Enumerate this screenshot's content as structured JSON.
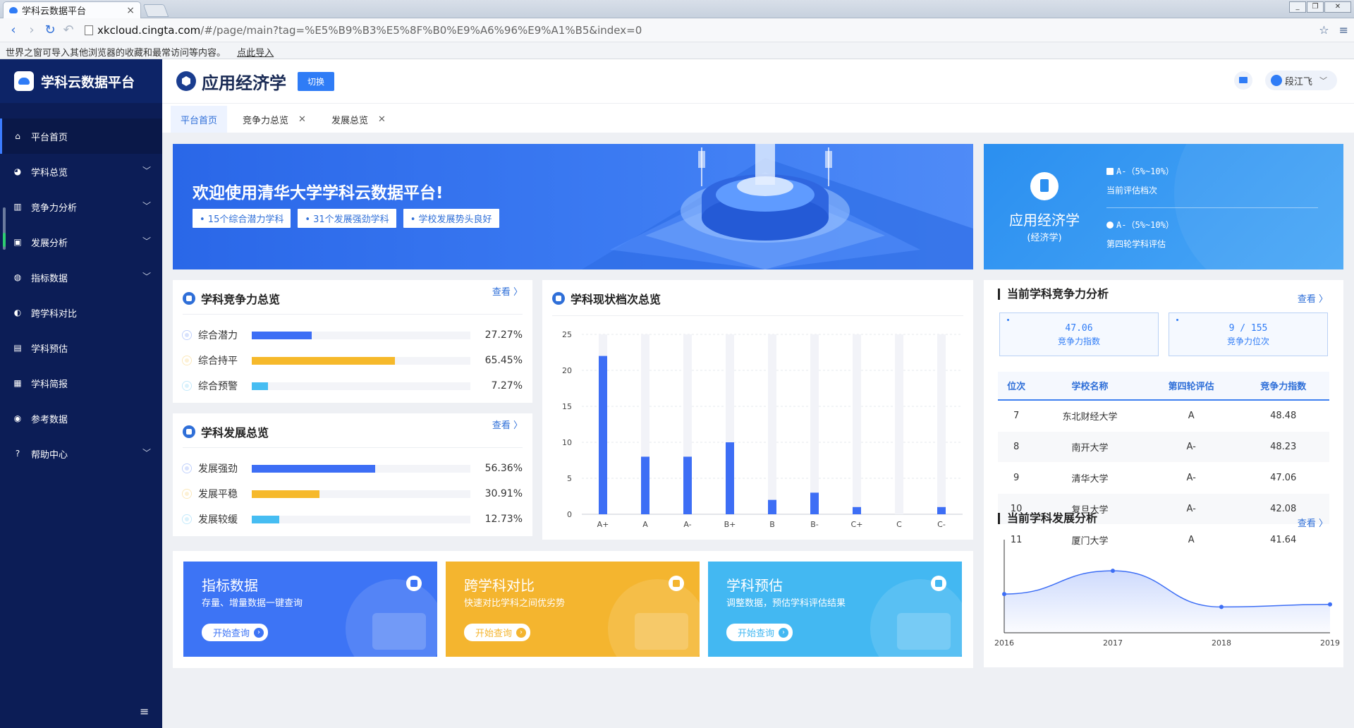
{
  "browser": {
    "tab_title": "学科云数据平台",
    "tab_close": "×",
    "url_host": "xkcloud.cingta.com",
    "url_rest": "/#/page/main?tag=%E5%B9%B3%E5%8F%B0%E9%A6%96%E9%A1%B5&index=0",
    "infobar_text": "世界之窗可导入其他浏览器的收藏和最常访问等内容。",
    "infobar_link": "点此导入"
  },
  "sidebar": {
    "brand": "学科云数据平台",
    "items": [
      {
        "label": "平台首页",
        "icon": "home-icon",
        "glyph": "⌂"
      },
      {
        "label": "学科总览",
        "icon": "pie-icon",
        "glyph": "◕"
      },
      {
        "label": "竞争力分析",
        "icon": "bar-chart-icon",
        "glyph": "▥"
      },
      {
        "label": "发展分析",
        "icon": "trend-icon",
        "glyph": "▣"
      },
      {
        "label": "指标数据",
        "icon": "gauge-icon",
        "glyph": "◍"
      },
      {
        "label": "跨学科对比",
        "icon": "contrast-icon",
        "glyph": "◐"
      },
      {
        "label": "学科预估",
        "icon": "doc-icon",
        "glyph": "▤"
      },
      {
        "label": "学科简报",
        "icon": "report-icon",
        "glyph": "▦"
      },
      {
        "label": "参考数据",
        "icon": "reference-icon",
        "glyph": "◉"
      },
      {
        "label": "帮助中心",
        "icon": "help-icon",
        "glyph": "?"
      }
    ],
    "bottom_icon": "≡"
  },
  "header": {
    "subject": "应用经济学",
    "switch_label": "切换",
    "user_name": "段江飞"
  },
  "tabs": [
    {
      "label": "平台首页"
    },
    {
      "label": "竞争力总览"
    },
    {
      "label": "发展总览"
    }
  ],
  "banner": {
    "title": "欢迎使用清华大学学科云数据平台!",
    "tags": [
      "• 15个综合潜力学科",
      "• 31个发展强劲学科",
      "• 学校发展势头良好"
    ]
  },
  "subject_card": {
    "name": "应用经济学",
    "sub": "(经济学)",
    "current_level": "A-（5%~10%）",
    "current_label": "当前评估档次",
    "fourth_level": "A-（5%~10%）",
    "fourth_label": "第四轮学科评估"
  },
  "competitiveness": {
    "title": "学科竞争力总览",
    "more": "查看 〉",
    "rows": [
      {
        "name": "综合潜力",
        "value": 27.27,
        "pct": "27.27%",
        "color": "#3d6ef5"
      },
      {
        "name": "综合持平",
        "value": 65.45,
        "pct": "65.45%",
        "color": "#f6b92b"
      },
      {
        "name": "综合预警",
        "value": 7.27,
        "pct": "7.27%",
        "color": "#46bdf2"
      }
    ]
  },
  "development": {
    "title": "学科发展总览",
    "more": "查看 〉",
    "rows": [
      {
        "name": "发展强劲",
        "value": 56.36,
        "pct": "56.36%",
        "color": "#3d6ef5"
      },
      {
        "name": "发展平稳",
        "value": 30.91,
        "pct": "30.91%",
        "color": "#f6b92b"
      },
      {
        "name": "发展较缓",
        "value": 12.73,
        "pct": "12.73%",
        "color": "#46bdf2"
      }
    ]
  },
  "level_chart": {
    "title": "学科现状档次总览"
  },
  "chart_data": [
    {
      "type": "bar",
      "title": "学科现状档次总览",
      "categories": [
        "A+",
        "A",
        "A-",
        "B+",
        "B",
        "B-",
        "C+",
        "C",
        "C-"
      ],
      "values": [
        22,
        8,
        8,
        10,
        2,
        3,
        1,
        0,
        1
      ],
      "ylim": [
        0,
        25
      ],
      "yticks": [
        0,
        5,
        10,
        15,
        20,
        25
      ],
      "grid": true,
      "color": "#3d6ef5"
    },
    {
      "type": "line",
      "title": "当前学科发展分析",
      "x": [
        "2016",
        "2017",
        "2018",
        "2019"
      ],
      "values": [
        0.45,
        0.72,
        0.3,
        0.33
      ],
      "color": "#3d6ef5"
    }
  ],
  "features": [
    {
      "title": "指标数据",
      "desc": "存量、增量数据一键查询",
      "btn": "开始查询",
      "color": "#3d74f5"
    },
    {
      "title": "跨学科对比",
      "desc": "快速对比学科之间优劣势",
      "btn": "开始查询",
      "color": "#f4b52f"
    },
    {
      "title": "学科预估",
      "desc": "调整数据，预估学科评估结果",
      "btn": "开始查询",
      "color": "#43b8f2"
    }
  ],
  "right": {
    "comp_title": "当前学科竞争力分析",
    "more": "查看 〉",
    "stat1_value": "47.06",
    "stat1_label": "竞争力指数",
    "stat2_value": "9 / 155",
    "stat2_label": "竞争力位次",
    "table_headers": [
      "位次",
      "学校名称",
      "第四轮评估",
      "竞争力指数"
    ],
    "rows": [
      [
        "7",
        "东北财经大学",
        "A",
        "48.48"
      ],
      [
        "8",
        "南开大学",
        "A-",
        "48.23"
      ],
      [
        "9",
        "清华大学",
        "A-",
        "47.06"
      ],
      [
        "10",
        "复旦大学",
        "A-",
        "42.08"
      ],
      [
        "11",
        "厦门大学",
        "A",
        "41.64"
      ]
    ],
    "dev_title": "当前学科发展分析"
  }
}
